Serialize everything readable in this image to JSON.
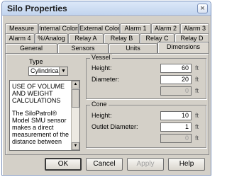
{
  "window": {
    "title": "Silo Properties",
    "close_label": "×"
  },
  "tabs": {
    "row1": [
      "Measure",
      "Internal Colors",
      "External Colors",
      "Alarm 1",
      "Alarm 2",
      "Alarm 3"
    ],
    "row2": [
      "Alarm 4",
      "%/Analog",
      "Relay A",
      "Relay B",
      "Relay C",
      "Relay D"
    ],
    "row3": [
      "General",
      "Sensors",
      "Units",
      "Dimensions"
    ],
    "active": "Dimensions"
  },
  "type_section": {
    "label": "Type",
    "selected": "Cylindrical",
    "arrow": "▼"
  },
  "description": {
    "heading": "USE OF VOLUME AND WEIGHT CALCULATIONS",
    "body": "The SiloPatrol® Model SMU sensor makes a direct measurement of the distance between",
    "scroll_up": "▲",
    "scroll_down": "▼"
  },
  "vessel": {
    "title": "Vessel",
    "height_label": "Height:",
    "height_value": "60",
    "height_unit": "ft",
    "diameter_label": "Diameter:",
    "diameter_value": "20",
    "diameter_unit": "ft",
    "extra_value": "0",
    "extra_unit": "ft"
  },
  "cone": {
    "title": "Cone",
    "height_label": "Height:",
    "height_value": "10",
    "height_unit": "ft",
    "outlet_label": "Outlet Diameter:",
    "outlet_value": "1",
    "outlet_unit": "ft",
    "extra_value": "0",
    "extra_unit": "ft"
  },
  "buttons": {
    "ok": "OK",
    "cancel": "Cancel",
    "apply": "Apply",
    "help": "Help"
  }
}
